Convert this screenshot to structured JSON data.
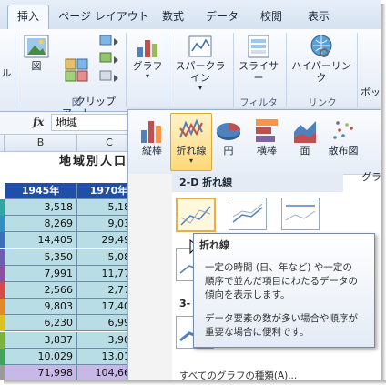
{
  "tabs": [
    "挿入",
    "ページ レイアウト",
    "数式",
    "データ",
    "校閲",
    "表示"
  ],
  "ribbon": {
    "left_cut_label": "ル",
    "picture": "図",
    "clipart": "クリップ\nアート",
    "shapes_group_label": "図",
    "chart": "グラフ",
    "sparkline": "スパークライン",
    "slicer": "スライサー",
    "hyperlink": "ハイパーリンク",
    "text_box": "テキ\nボッ",
    "group_filter": "フィルター",
    "group_link": "リンク"
  },
  "formula_bar": {
    "fx": "fx",
    "content": "地域"
  },
  "sheet": {
    "col_headers": [
      "B",
      "C"
    ],
    "title": "地域別人口変",
    "year_headers": [
      "1945年",
      "1970年"
    ],
    "rows": [
      [
        "3,518",
        "5,184"
      ],
      [
        "8,269",
        "9,031"
      ],
      [
        "14,405",
        "29,496"
      ],
      [
        "5,350",
        "5,080"
      ],
      [
        "7,991",
        "11,778"
      ],
      [
        "2,566",
        "2,776"
      ],
      [
        "9,803",
        "17,401"
      ],
      [
        "6,230",
        "6,997"
      ],
      [
        "3,837",
        "3,904"
      ],
      [
        "10,029",
        "13,017"
      ],
      [
        "71,998",
        "104,665"
      ]
    ],
    "row_colors": [
      "#2fa6a0",
      "#2f8fc0",
      "#3a6fb8",
      "#6a5fb0",
      "#8a4f9f",
      "#d24a4a",
      "#e08a2a",
      "#d9c21e",
      "#7bb33b",
      "#3fa35a",
      "#9a9a9a"
    ],
    "partial_d": [
      "1",
      "1",
      "2",
      "1"
    ]
  },
  "chart_menu": {
    "types": [
      "縦棒",
      "折れ線",
      "円",
      "横棒",
      "面",
      "散布図",
      "その\nグラ"
    ],
    "selected_index": 1,
    "sub_2d": "2-D 折れ線",
    "sub_3d": "3-",
    "bottom_cut": "すべてのグラフの種類(A)..."
  },
  "tooltip": {
    "title": "折れ線",
    "line1": "一定の時間 (日、年など) や一定の",
    "line2": "順序で並んだ項目にわたるデータの",
    "line3": "傾向を表示します。",
    "line4": "データ要素の数が多い場合や順序が",
    "line5": "重要な場合に便利です。"
  },
  "colors": {
    "tab_bar": "#d6e2f1",
    "header_blue": "#1f4fa8",
    "cell_fill": "#b9dde4",
    "total_fill": "#c8b8e8",
    "highlight": "#ffd977"
  }
}
